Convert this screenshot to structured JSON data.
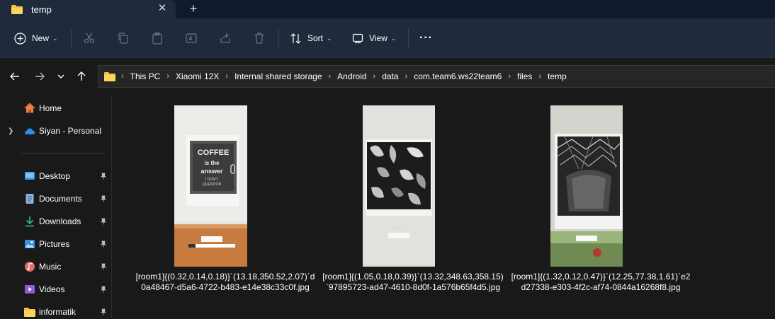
{
  "window": {
    "tab_title": "temp",
    "tab_close": "✕",
    "new_tab": "+"
  },
  "toolbar": {
    "new_label": "New",
    "sort_label": "Sort",
    "view_label": "View",
    "more_label": "···",
    "caret": "⌄"
  },
  "address": {
    "crumbs": [
      "This PC",
      "Xiaomi 12X",
      "Internal shared storage",
      "Android",
      "data",
      "com.team6.ws22team6",
      "files",
      "temp"
    ],
    "separator": "›"
  },
  "sidebar": {
    "items": [
      {
        "label": "Home",
        "icon": "home-icon",
        "pinned": false
      },
      {
        "label": "Siyan - Personal",
        "icon": "cloud-icon",
        "pinned": false,
        "expandable": true
      },
      {
        "label": "Desktop",
        "icon": "desktop-icon",
        "pinned": true
      },
      {
        "label": "Documents",
        "icon": "documents-icon",
        "pinned": true
      },
      {
        "label": "Downloads",
        "icon": "downloads-icon",
        "pinned": true
      },
      {
        "label": "Pictures",
        "icon": "pictures-icon",
        "pinned": true
      },
      {
        "label": "Music",
        "icon": "music-icon",
        "pinned": true
      },
      {
        "label": "Videos",
        "icon": "videos-icon",
        "pinned": true
      },
      {
        "label": "informatik",
        "icon": "folder-icon",
        "pinned": true
      }
    ]
  },
  "files": [
    {
      "name_line1": "[room1]{(0.32,0.14,0.18)}`(13.18,350.52,2.07)`d",
      "name_line2": "0a48467-d5a6-4722-b483-e14e38c33c0f.jpg",
      "thumb": "coffee-poster"
    },
    {
      "name_line1": "[room1]{(1.05,0.18,0.39)}`(13.32,348.63,358.15)",
      "name_line2": "`97895723-ad47-4610-8d0f-1a576b65f4d5.jpg",
      "thumb": "plants-poster"
    },
    {
      "name_line1": "[room1]{(1.32,0.12,0.47)}`(12.25,77.38,1.61)`e2",
      "name_line2": "d27338-e303-4f2c-af74-0844a16268f8.jpg",
      "thumb": "structure-poster"
    }
  ],
  "colors": {
    "titlebar": "#0f1a2e",
    "toolbar": "#1f2a3d",
    "background": "#191919",
    "folder_yellow": "#f4c542"
  }
}
